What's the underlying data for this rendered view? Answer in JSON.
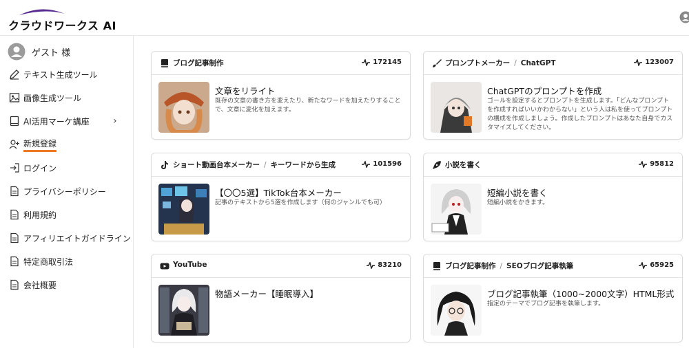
{
  "app": {
    "logo_text": "クラウドワークス AI"
  },
  "sidebar": {
    "user_label": "ゲスト 様",
    "items": [
      {
        "label": "テキスト生成ツール",
        "icon": "pen-icon"
      },
      {
        "label": "画像生成ツール",
        "icon": "image-icon"
      },
      {
        "label": "AI活用マーケ講座",
        "icon": "book-icon"
      },
      {
        "label": "新規登録",
        "icon": "user-plus-icon"
      },
      {
        "label": "ログイン",
        "icon": "login-icon"
      },
      {
        "label": "プライバシーポリシー",
        "icon": "document-icon"
      },
      {
        "label": "利用規約",
        "icon": "document-icon"
      },
      {
        "label": "アフィリエイトガイドライン",
        "icon": "document-icon"
      },
      {
        "label": "特定商取引法",
        "icon": "document-icon"
      },
      {
        "label": "会社概要",
        "icon": "document-icon"
      }
    ]
  },
  "cards": [
    {
      "category": "ブログ記事制作",
      "subcategory": "",
      "count": "172145",
      "title": "文章をリライト",
      "description": "既存の文章の書き方を変えたり、新たなワードを加えたりすることで、文章に変化を加えます。",
      "icon": "book-icon"
    },
    {
      "category": "プロンプトメーカー",
      "subcategory": "ChatGPT",
      "count": "123007",
      "title": "ChatGPTのプロンプトを作成",
      "description": "ゴールを設定するとプロンプトを生成します。「どんなプロンプトを作成すればいいかわからない」という人は私を使ってプロンプトの構成を作成しましょう。作成したプロンプトはあなた自身でカスタマイズしてください。",
      "icon": "brush-icon"
    },
    {
      "category": "ショート動画台本メーカー",
      "subcategory": "キーワードから生成",
      "count": "101596",
      "title": "【〇〇5選】TikTok台本メーカー",
      "description": "記事のテキストから5選を作成します（何のジャンルでも可）",
      "icon": "tiktok-icon"
    },
    {
      "category": "小説を書く",
      "subcategory": "",
      "count": "95812",
      "title": "短編小説を書く",
      "description": "短編小説をかきます。",
      "icon": "pen-nib-icon"
    },
    {
      "category": "YouTube",
      "subcategory": "",
      "count": "83210",
      "title": "物語メーカー【睡眠導入】",
      "description": "",
      "icon": "youtube-icon"
    },
    {
      "category": "ブログ記事制作",
      "subcategory": "SEOブログ記事執筆",
      "count": "65925",
      "title": "ブログ記事執筆（1000~2000文字）HTML形式",
      "description": "指定のテーマでブログ記事を執筆します。",
      "icon": "book-icon"
    }
  ],
  "colors": {
    "accent": "#f07a22",
    "logo_purple": "#5a2d91"
  }
}
